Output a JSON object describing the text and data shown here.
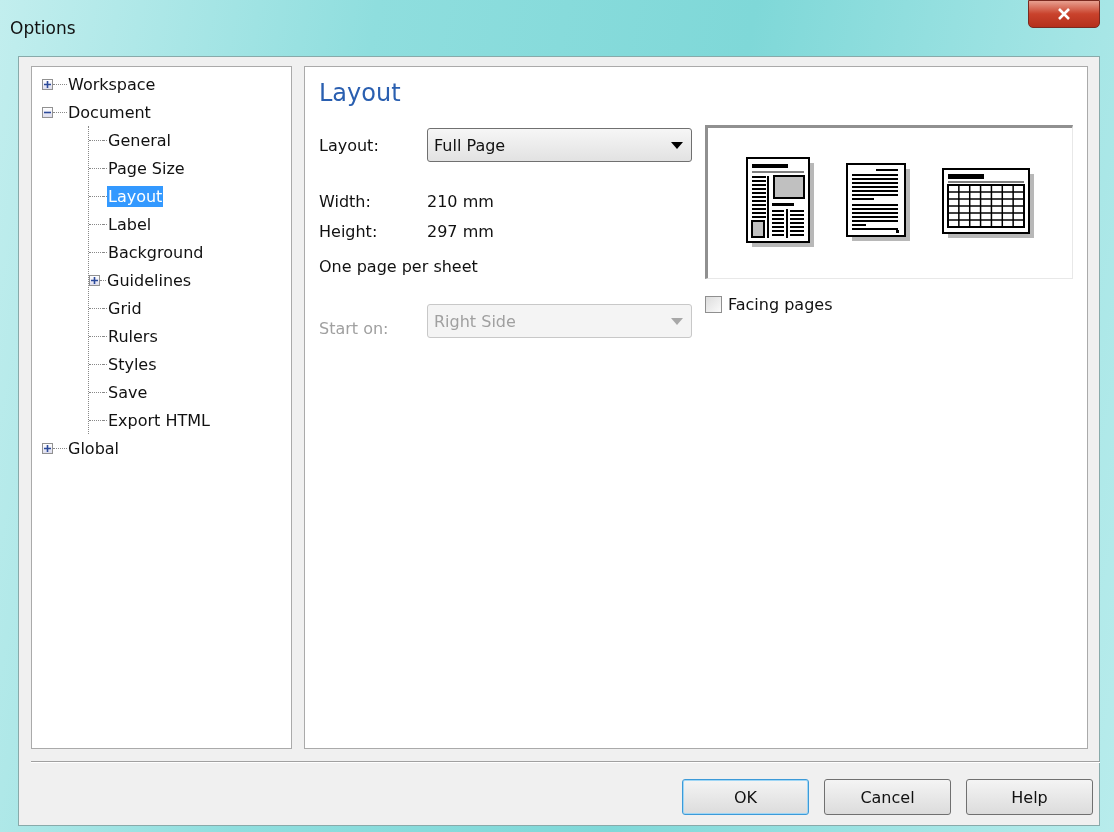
{
  "window": {
    "title": "Options"
  },
  "tree": [
    {
      "label": "Workspace",
      "kind": "folder",
      "expanded": false,
      "selected": false
    },
    {
      "label": "Document",
      "kind": "folder",
      "expanded": true,
      "selected": false,
      "children": [
        {
          "label": "General",
          "kind": "leaf",
          "selected": false
        },
        {
          "label": "Page Size",
          "kind": "leaf",
          "selected": false
        },
        {
          "label": "Layout",
          "kind": "leaf",
          "selected": true
        },
        {
          "label": "Label",
          "kind": "leaf",
          "selected": false
        },
        {
          "label": "Background",
          "kind": "leaf",
          "selected": false
        },
        {
          "label": "Guidelines",
          "kind": "folder",
          "expanded": false,
          "selected": false
        },
        {
          "label": "Grid",
          "kind": "leaf",
          "selected": false
        },
        {
          "label": "Rulers",
          "kind": "leaf",
          "selected": false
        },
        {
          "label": "Styles",
          "kind": "leaf",
          "selected": false
        },
        {
          "label": "Save",
          "kind": "leaf",
          "selected": false
        },
        {
          "label": "Export HTML",
          "kind": "leaf",
          "selected": false
        }
      ]
    },
    {
      "label": "Global",
      "kind": "folder",
      "expanded": false,
      "selected": false
    }
  ],
  "panel": {
    "title": "Layout",
    "fields": [
      {
        "kind": "select",
        "label": "Layout:",
        "value": "Full Page",
        "disabled": false
      },
      {
        "kind": "value",
        "label": "Width:",
        "value": "210 mm"
      },
      {
        "kind": "value",
        "label": "Height:",
        "value": "297 mm"
      },
      {
        "kind": "note",
        "text": "One page per sheet"
      },
      {
        "kind": "select",
        "label": "Start on:",
        "value": "Right Side",
        "disabled": true
      }
    ],
    "facing_pages": {
      "label": "Facing pages",
      "checked": false
    }
  },
  "buttons": [
    {
      "label": "OK",
      "default": true
    },
    {
      "label": "Cancel",
      "default": false
    },
    {
      "label": "Help",
      "default": false
    }
  ]
}
